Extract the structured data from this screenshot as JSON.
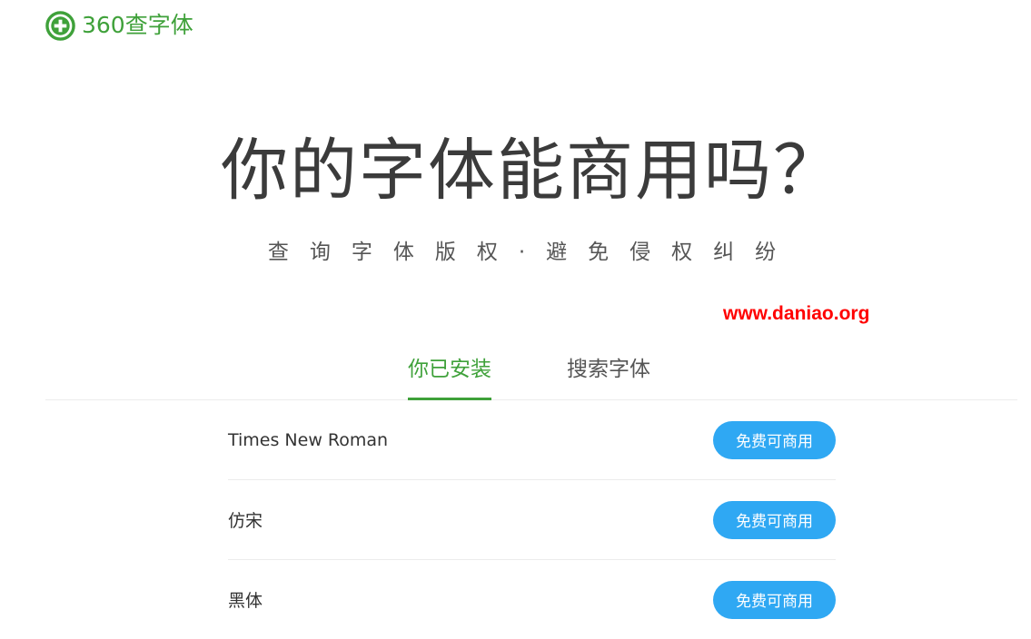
{
  "logo": {
    "icon": "plus-circle-icon",
    "text": "360查字体",
    "color": "#3fa13a"
  },
  "hero": {
    "title": "你的字体能商用吗？",
    "subtitle": "查询字体版权·避免侵权纠纷"
  },
  "watermark": {
    "text": "www.daniao.org",
    "color": "#ff0000"
  },
  "tabs": [
    {
      "label": "你已安装",
      "active": true
    },
    {
      "label": "搜索字体",
      "active": false
    }
  ],
  "fonts": [
    {
      "name": "Times New Roman",
      "status": "免费可商用"
    },
    {
      "name": "仿宋",
      "status": "免费可商用"
    },
    {
      "name": "黑体",
      "status": "免费可商用"
    }
  ],
  "colors": {
    "accent": "#3fa13a",
    "status_button": "#2fa8f3"
  }
}
